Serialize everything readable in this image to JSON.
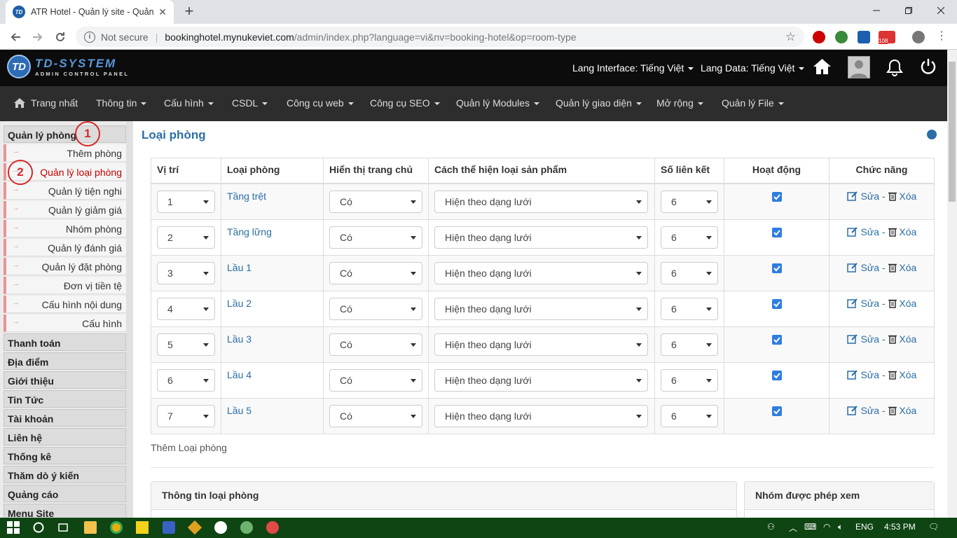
{
  "browser": {
    "tab_title": "ATR Hotel - Quản lý site - Quản lý",
    "favicon_text": "TD",
    "new_tab": "+",
    "security": "Not secure",
    "url_host": "bookinghotel.mynukeviet.com",
    "url_path": "/admin/index.php?language=vi&nv=booking-hotel&op=room-type",
    "ext_badge": "108"
  },
  "header": {
    "logo_letters": "TD",
    "logo_title": "TD-SYSTEM",
    "logo_subtitle": "ADMIN CONTROL PANEL",
    "lang_interface": "Lang Interface: Tiếng Việt",
    "lang_data": "Lang Data: Tiếng Việt"
  },
  "menu": [
    {
      "label": "Trang nhất"
    },
    {
      "label": "Thông tin"
    },
    {
      "label": "Cấu hình"
    },
    {
      "label": "CSDL"
    },
    {
      "label": "Công cụ web"
    },
    {
      "label": "Công cụ SEO"
    },
    {
      "label": "Quản lý Modules"
    },
    {
      "label": "Quản lý giao diện"
    },
    {
      "label": "Mở rộng"
    },
    {
      "label": "Quản lý File"
    }
  ],
  "sidebar": {
    "module_title": "Quản lý phòng",
    "subitems": [
      "Thêm phòng",
      "Quản lý loại phòng",
      "Quản lý tiện nghi",
      "Quản lý giảm giá",
      "Nhóm phòng",
      "Quản lý đánh giá",
      "Quản lý đặt phòng",
      "Đơn vị tiền tệ",
      "Cấu hình nội dung",
      "Cấu hình"
    ],
    "modules": [
      "Thanh toán",
      "Địa điểm",
      "Giới thiệu",
      "Tin Tức",
      "Tài khoản",
      "Liên hệ",
      "Thống kê",
      "Thăm dò ý kiến",
      "Quảng cáo",
      "Menu Site"
    ],
    "annotations": [
      "1",
      "2"
    ]
  },
  "page": {
    "title": "Loại phòng",
    "columns": [
      "Vị trí",
      "Loại phòng",
      "Hiển thị trang chủ",
      "Cách thể hiện loại sản phẩm",
      "Số liên kết",
      "Hoạt động",
      "Chức năng"
    ],
    "rows": [
      {
        "pos": "1",
        "name": "Tầng trệt",
        "home": "Có",
        "display": "Hiện theo dạng lưới",
        "links": "6",
        "active": true
      },
      {
        "pos": "2",
        "name": "Tầng lững",
        "home": "Có",
        "display": "Hiện theo dạng lưới",
        "links": "6",
        "active": true
      },
      {
        "pos": "3",
        "name": "Lầu 1",
        "home": "Có",
        "display": "Hiện theo dạng lưới",
        "links": "6",
        "active": true
      },
      {
        "pos": "4",
        "name": "Lầu 2",
        "home": "Có",
        "display": "Hiện theo dạng lưới",
        "links": "6",
        "active": true
      },
      {
        "pos": "5",
        "name": "Lầu 3",
        "home": "Có",
        "display": "Hiện theo dạng lưới",
        "links": "6",
        "active": true
      },
      {
        "pos": "6",
        "name": "Lầu 4",
        "home": "Có",
        "display": "Hiện theo dạng lưới",
        "links": "6",
        "active": true
      },
      {
        "pos": "7",
        "name": "Lầu 5",
        "home": "Có",
        "display": "Hiện theo dạng lưới",
        "links": "6",
        "active": true
      }
    ],
    "edit_label": "Sửa",
    "action_sep": " - ",
    "delete_label": "Xóa",
    "add_label": "Thêm Loại phòng",
    "panel_info": "Thông tin loại phòng",
    "panel_groups": "Nhóm được phép xem"
  },
  "taskbar": {
    "lang": "ENG",
    "time": "4:53 PM"
  },
  "colors": {
    "link": "#2a6ea6",
    "active_item": "#c40000",
    "annotation": "#d62828",
    "checkbox": "#2f7de1"
  }
}
